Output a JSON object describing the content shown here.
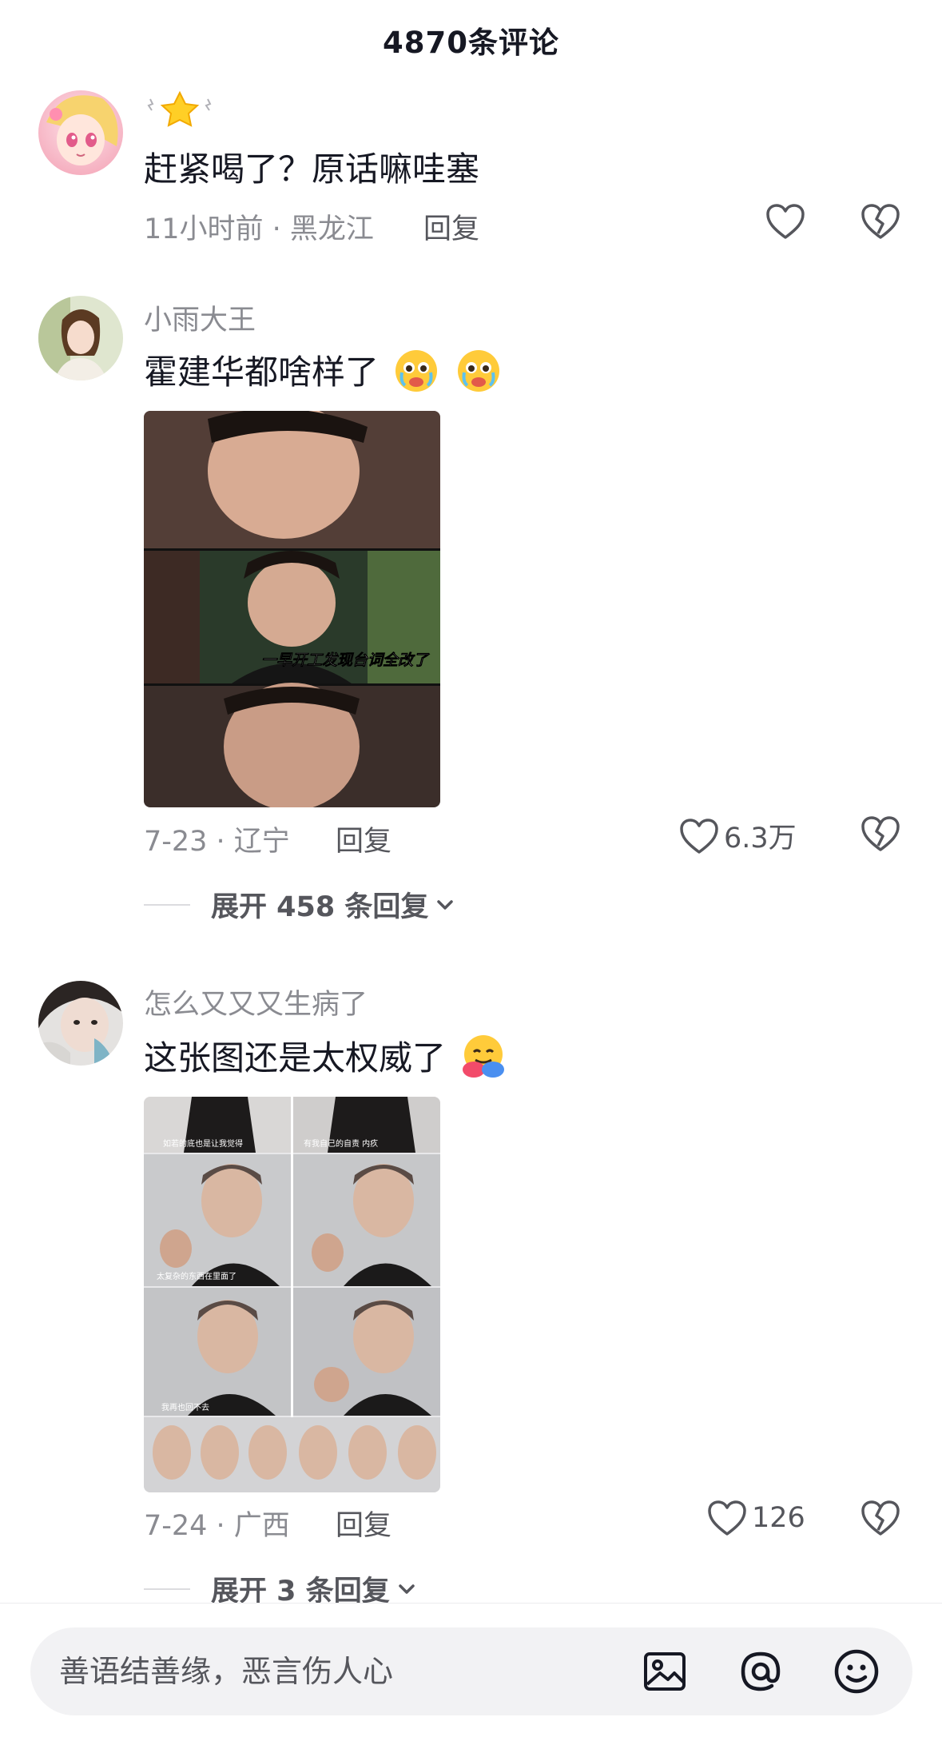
{
  "header": {
    "title": "4870条评论"
  },
  "comments": [
    {
      "username": "",
      "username_symbol": "⭐",
      "content": "赶紧喝了？原话嘛哇塞",
      "meta": "11小时前 · 黑龙江",
      "reply_label": "回复",
      "like_count": ""
    },
    {
      "username": "小雨大王",
      "content": "霍建华都啥样了",
      "emoji": "crying-emoji",
      "media_caption": "一早开工发现台词全改了",
      "meta": "7-23 · 辽宁",
      "reply_label": "回复",
      "like_count": "6.3万",
      "expand_label": "展开 458 条回复"
    },
    {
      "username": "怎么又又又生病了",
      "content": "这张图还是太权威了",
      "emoji": "hugging-emoji",
      "media_captions": [
        "如若的底也是让我觉得",
        "有我自己的自责 内疚",
        "太复杂的东西在里面了",
        "我再也回不去"
      ],
      "meta": "7-24 · 广西",
      "reply_label": "回复",
      "like_count": "126",
      "expand_label": "展开 3 条回复"
    }
  ],
  "input": {
    "placeholder": "善语结善缘，恶言伤人心"
  },
  "icons": {
    "like": "heart-outline-icon",
    "dislike": "broken-heart-icon",
    "image": "image-icon",
    "mention": "at-icon",
    "emoji": "smiley-icon"
  },
  "colors": {
    "text_primary": "#161823",
    "text_secondary": "#8a8b91",
    "input_bg": "#f2f2f4"
  }
}
